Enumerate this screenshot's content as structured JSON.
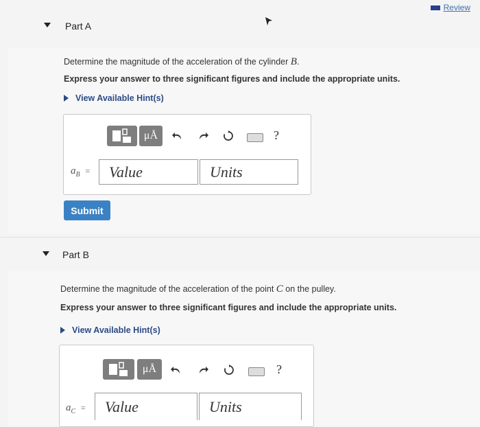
{
  "review": {
    "label": "Review",
    "icon": "review-icon"
  },
  "parts": [
    {
      "label": "Part A",
      "question_prefix": "Determine the magnitude of the acceleration of the cylinder",
      "question_var": "B",
      "question_suffix": ".",
      "instruction": "Express your answer to three significant figures and include the appropriate units.",
      "hint": "View Available Hint(s)",
      "var_main": "a",
      "var_sub": "B",
      "equals": "=",
      "value_placeholder": "Value",
      "units_placeholder": "Units",
      "submit": "Submit"
    },
    {
      "label": "Part B",
      "question_prefix": "Determine the magnitude of the acceleration of the point",
      "question_var": "C",
      "question_suffix": "on the pulley.",
      "instruction": "Express your answer to three significant figures and include the appropriate units.",
      "hint": "View Available Hint(s)",
      "var_main": "a",
      "var_sub": "C",
      "equals": "=",
      "value_placeholder": "Value",
      "units_placeholder": "Units"
    }
  ],
  "toolbar": {
    "units_symbol": "μÅ",
    "help": "?"
  }
}
